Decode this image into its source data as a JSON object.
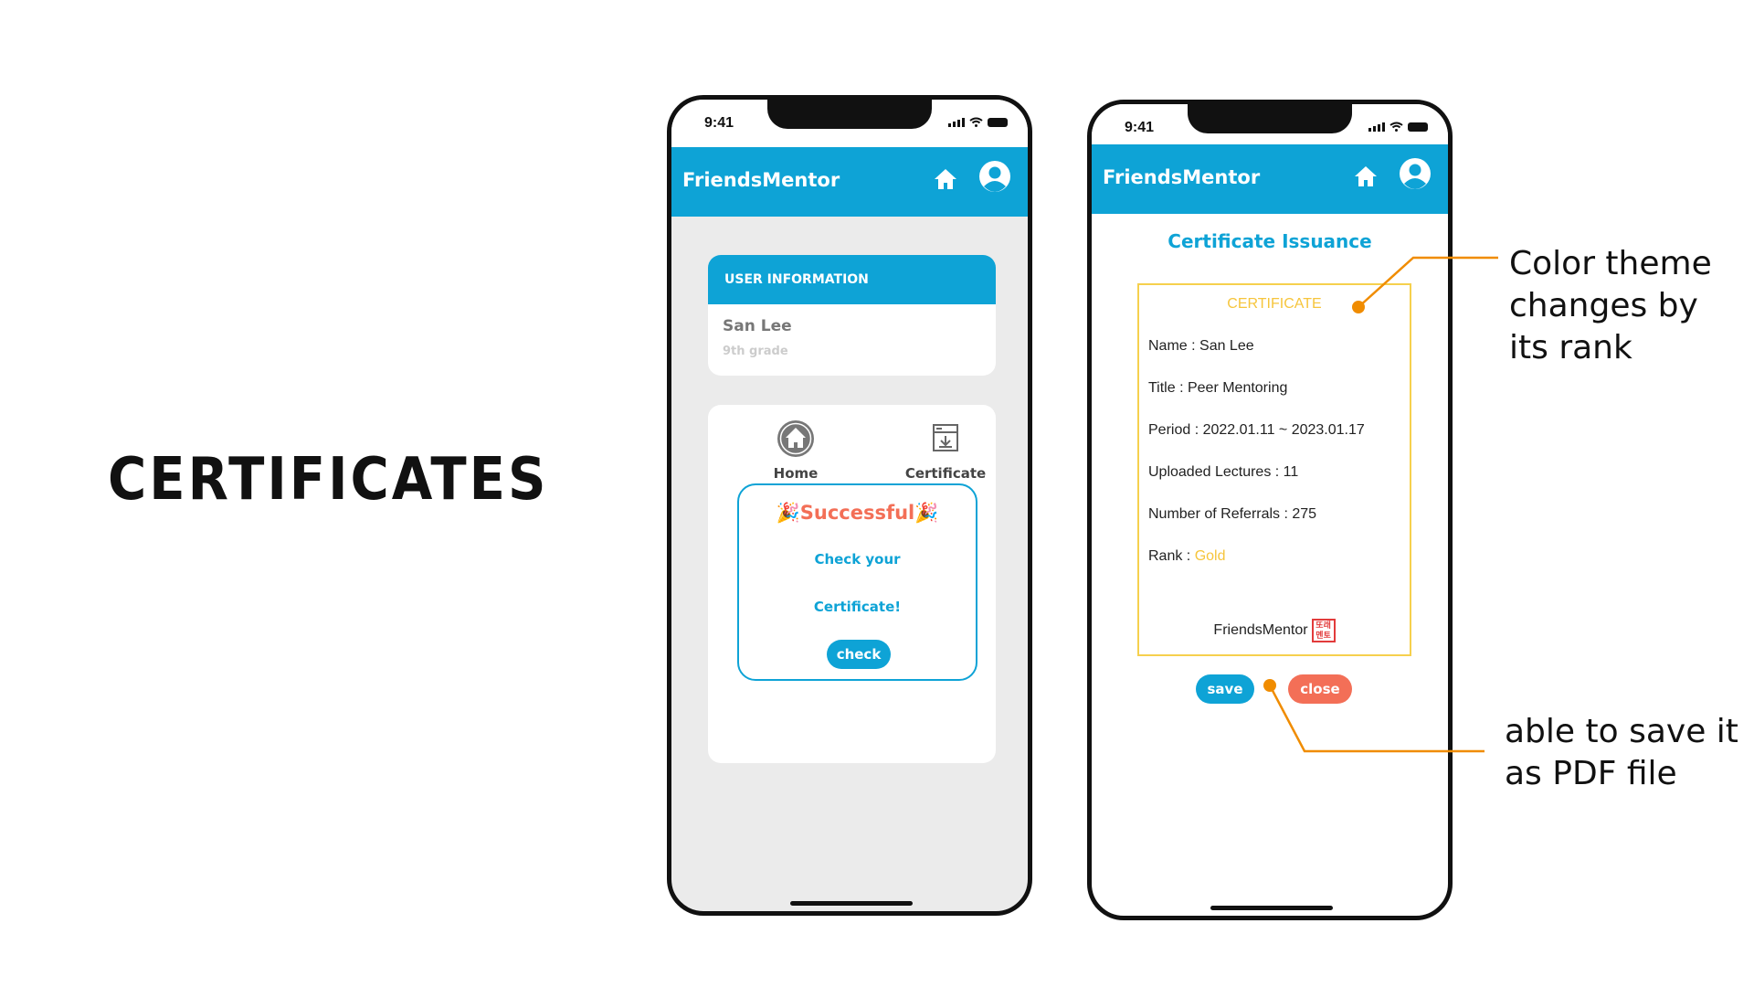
{
  "slide": {
    "title": "CERTIFICATES"
  },
  "phone": {
    "time": "9:41",
    "app_name": "FriendsMentor",
    "icons": [
      "home-icon",
      "user-icon"
    ]
  },
  "left_screen": {
    "user_card": {
      "header": "USER INFORMATION",
      "name": "San Lee",
      "grade": "9th grade"
    },
    "nav": [
      {
        "label": "Home",
        "icon": "home-circle-icon"
      },
      {
        "label": "Certificate",
        "icon": "certificate-icon"
      }
    ],
    "popup": {
      "title": "🎉Successful🎉",
      "line1": "Check your",
      "line2": "Certificate!",
      "button": "check"
    }
  },
  "right_screen": {
    "title": "Certificate Issuance",
    "certificate": {
      "header": "CERTIFICATE",
      "name": "Name : San Lee",
      "title": "Title : Peer Mentoring",
      "period": "Period : 2022.01.11 ~ 2023.01.17",
      "lectures": "Uploaded Lectures : 11",
      "referrals": "Number of Referrals : 275",
      "rank_label": "Rank :",
      "rank_value": "Gold",
      "footer": "FriendsMentor",
      "stamp": "또래멘토"
    },
    "buttons": {
      "save": "save",
      "close": "close"
    }
  },
  "annotations": {
    "color_theme": "Color theme changes by its rank",
    "pdf": "able to save it as PDF file"
  },
  "colors": {
    "primary": "#0ea3d6",
    "accent": "#f36f57",
    "gold": "#f6c53c",
    "pointer": "#f08c00"
  }
}
